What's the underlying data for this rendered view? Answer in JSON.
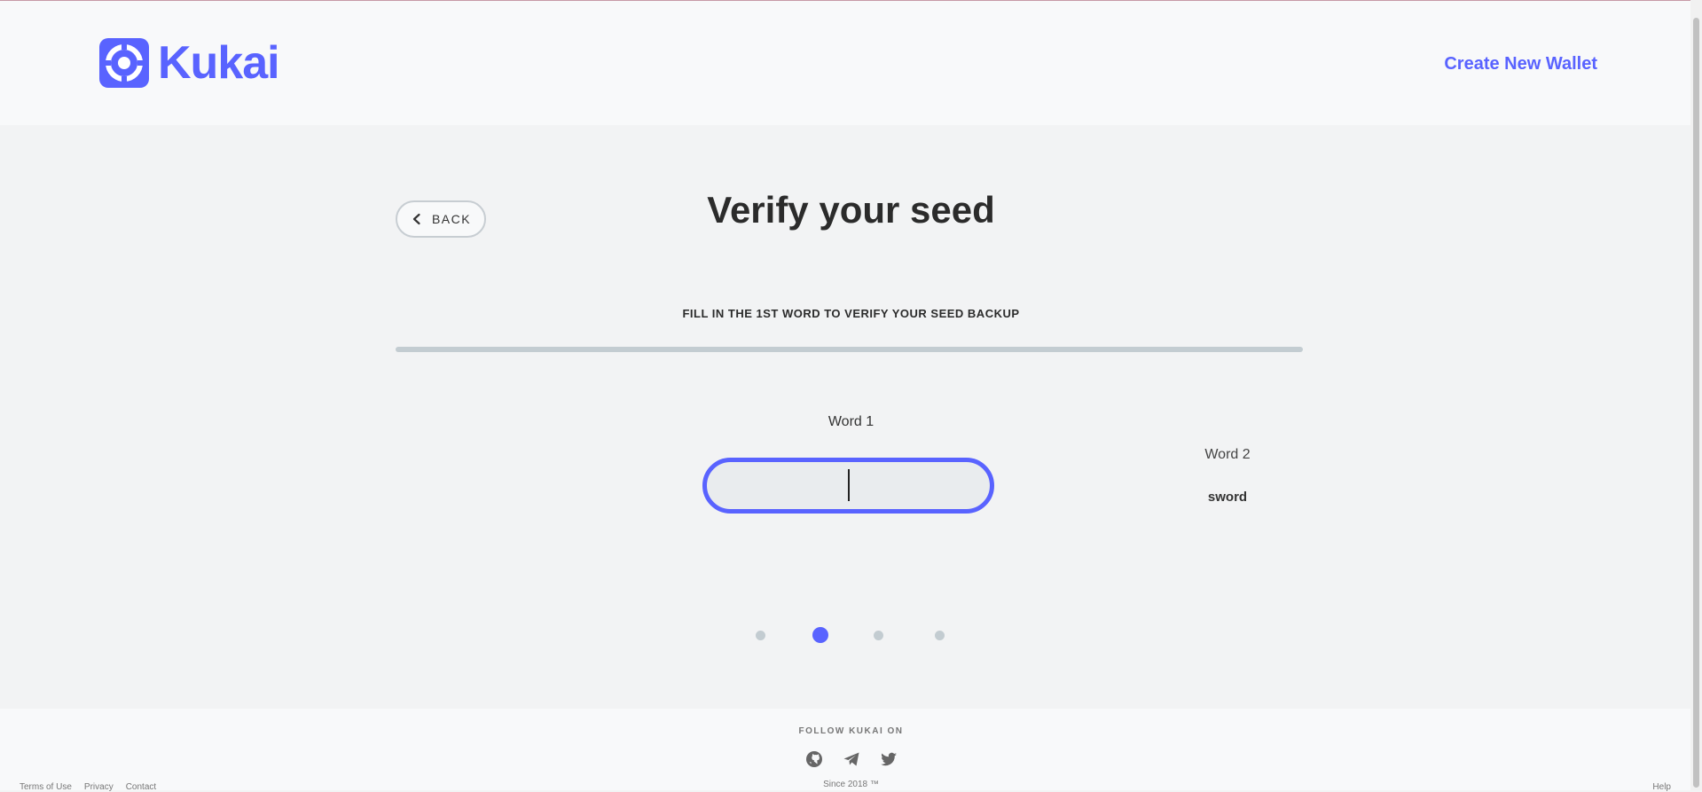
{
  "header": {
    "logo_text": "Kukai",
    "create_wallet_label": "Create New Wallet"
  },
  "colors": {
    "brand": "#5963ff",
    "inactive": "#c3ccd1",
    "background": "#f2f3f4"
  },
  "main": {
    "back_label": "BACK",
    "title": "Verify your seed",
    "instruction": "FILL IN THE 1ST WORD TO VERIFY YOUR SEED BACKUP",
    "progress_fraction": 0,
    "word1": {
      "label": "Word 1",
      "value": ""
    },
    "word2": {
      "label": "Word 2",
      "value": "sword"
    },
    "steps": {
      "count": 4,
      "active_index": 1
    }
  },
  "footer": {
    "follow_label": "FOLLOW KUKAI ON",
    "social_icons": [
      "github-icon",
      "telegram-icon",
      "twitter-icon"
    ],
    "since_label": "Since 2018 ™",
    "legal_links": [
      "Terms of Use",
      "Privacy",
      "Contact"
    ],
    "help_label": "Help"
  }
}
